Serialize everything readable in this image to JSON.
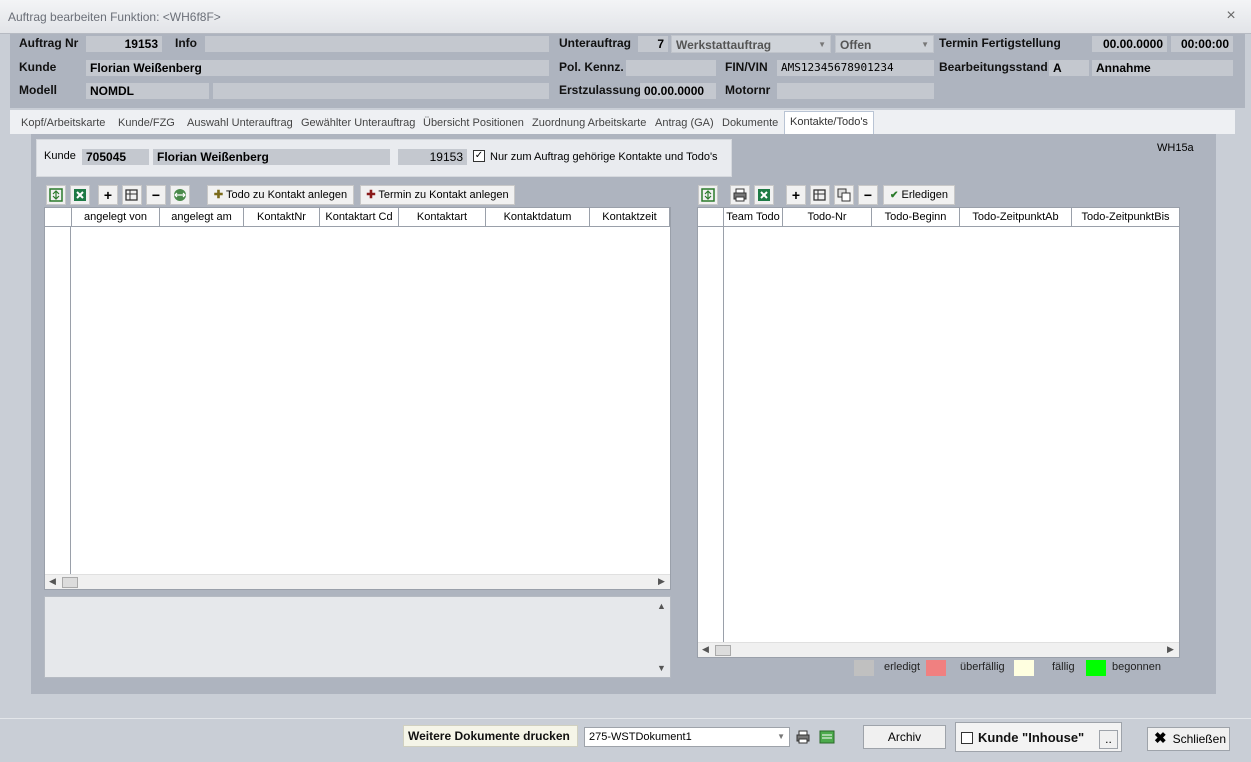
{
  "window": {
    "title": "Auftrag bearbeiten   Funktion: <WH6f8F>",
    "close_label": "×"
  },
  "header": {
    "auftrag_nr_label": "Auftrag Nr",
    "auftrag_nr_value": "19153",
    "info_label": "Info",
    "info_value": "",
    "unterauftrag_label": "Unterauftrag",
    "unterauftrag_nr": "7",
    "unterauftrag_type": "Werkstattauftrag",
    "status": "Offen",
    "termin_label": "Termin Fertigstellung",
    "termin_date": "00.00.0000",
    "termin_time": "00:00:00",
    "kunde_label": "Kunde",
    "kunde_value": "Florian Weißenberg",
    "pol_kennz_label": "Pol. Kennz.",
    "pol_kennz_value": "",
    "fin_label": "FIN/VIN",
    "fin_value": "AMS12345678901234",
    "bearb_label": "Bearbeitungsstand",
    "bearb_code": "A",
    "bearb_value": "Annahme",
    "modell_label": "Modell",
    "modell_value": "NOMDL",
    "modell_extra": "",
    "erstzulassung_label": "Erstzulassung",
    "erstzulassung_value": "00.00.0000",
    "motornr_label": "Motornr",
    "motornr_value": ""
  },
  "tabs": [
    {
      "label": "Kopf/Arbeitskarte"
    },
    {
      "label": "Kunde/FZG"
    },
    {
      "label": "Auswahl Unterauftrag"
    },
    {
      "label": "Gewählter Unterauftrag"
    },
    {
      "label": "Übersicht Positionen"
    },
    {
      "label": "Zuordnung Arbeitskarte"
    },
    {
      "label": "Antrag (GA)"
    },
    {
      "label": "Dokumente"
    },
    {
      "label": "Kontakte/Todo's"
    }
  ],
  "contacts": {
    "kunde_label": "Kunde",
    "kunde_nr": "705045",
    "kunde_name": "Florian Weißenberg",
    "auftrag_nr": "19153",
    "filter_label": "Nur zum Auftrag gehörige Kontakte und Todo's",
    "form_id": "WH15a",
    "todo_button": "Todo zu Kontakt anlegen",
    "termin_button": "Termin zu Kontakt anlegen",
    "columns": [
      "angelegt von",
      "angelegt am",
      "KontaktNr",
      "Kontaktart Cd",
      "Kontaktart",
      "Kontaktdatum",
      "Kontaktzeit"
    ]
  },
  "todos": {
    "erledigen_button": "Erledigen",
    "columns": [
      "Team Todo",
      "Todo-Nr",
      "Todo-Beginn",
      "Todo-ZeitpunktAb",
      "Todo-ZeitpunktBis"
    ],
    "legend": [
      {
        "label": "erledigt",
        "color": "#c0c0c0"
      },
      {
        "label": "überfällig",
        "color": "#f08080"
      },
      {
        "label": "fällig",
        "color": "#ffffe0"
      },
      {
        "label": "begonnen",
        "color": "#00ff00"
      }
    ]
  },
  "footer": {
    "print_label": "Weitere Dokumente drucken",
    "document_select": "275-WSTDokument1",
    "archiv_button": "Archiv",
    "inhouse_label": "Kunde \"Inhouse\"",
    "ellipsis_button": "..",
    "close_button": "Schließen"
  }
}
